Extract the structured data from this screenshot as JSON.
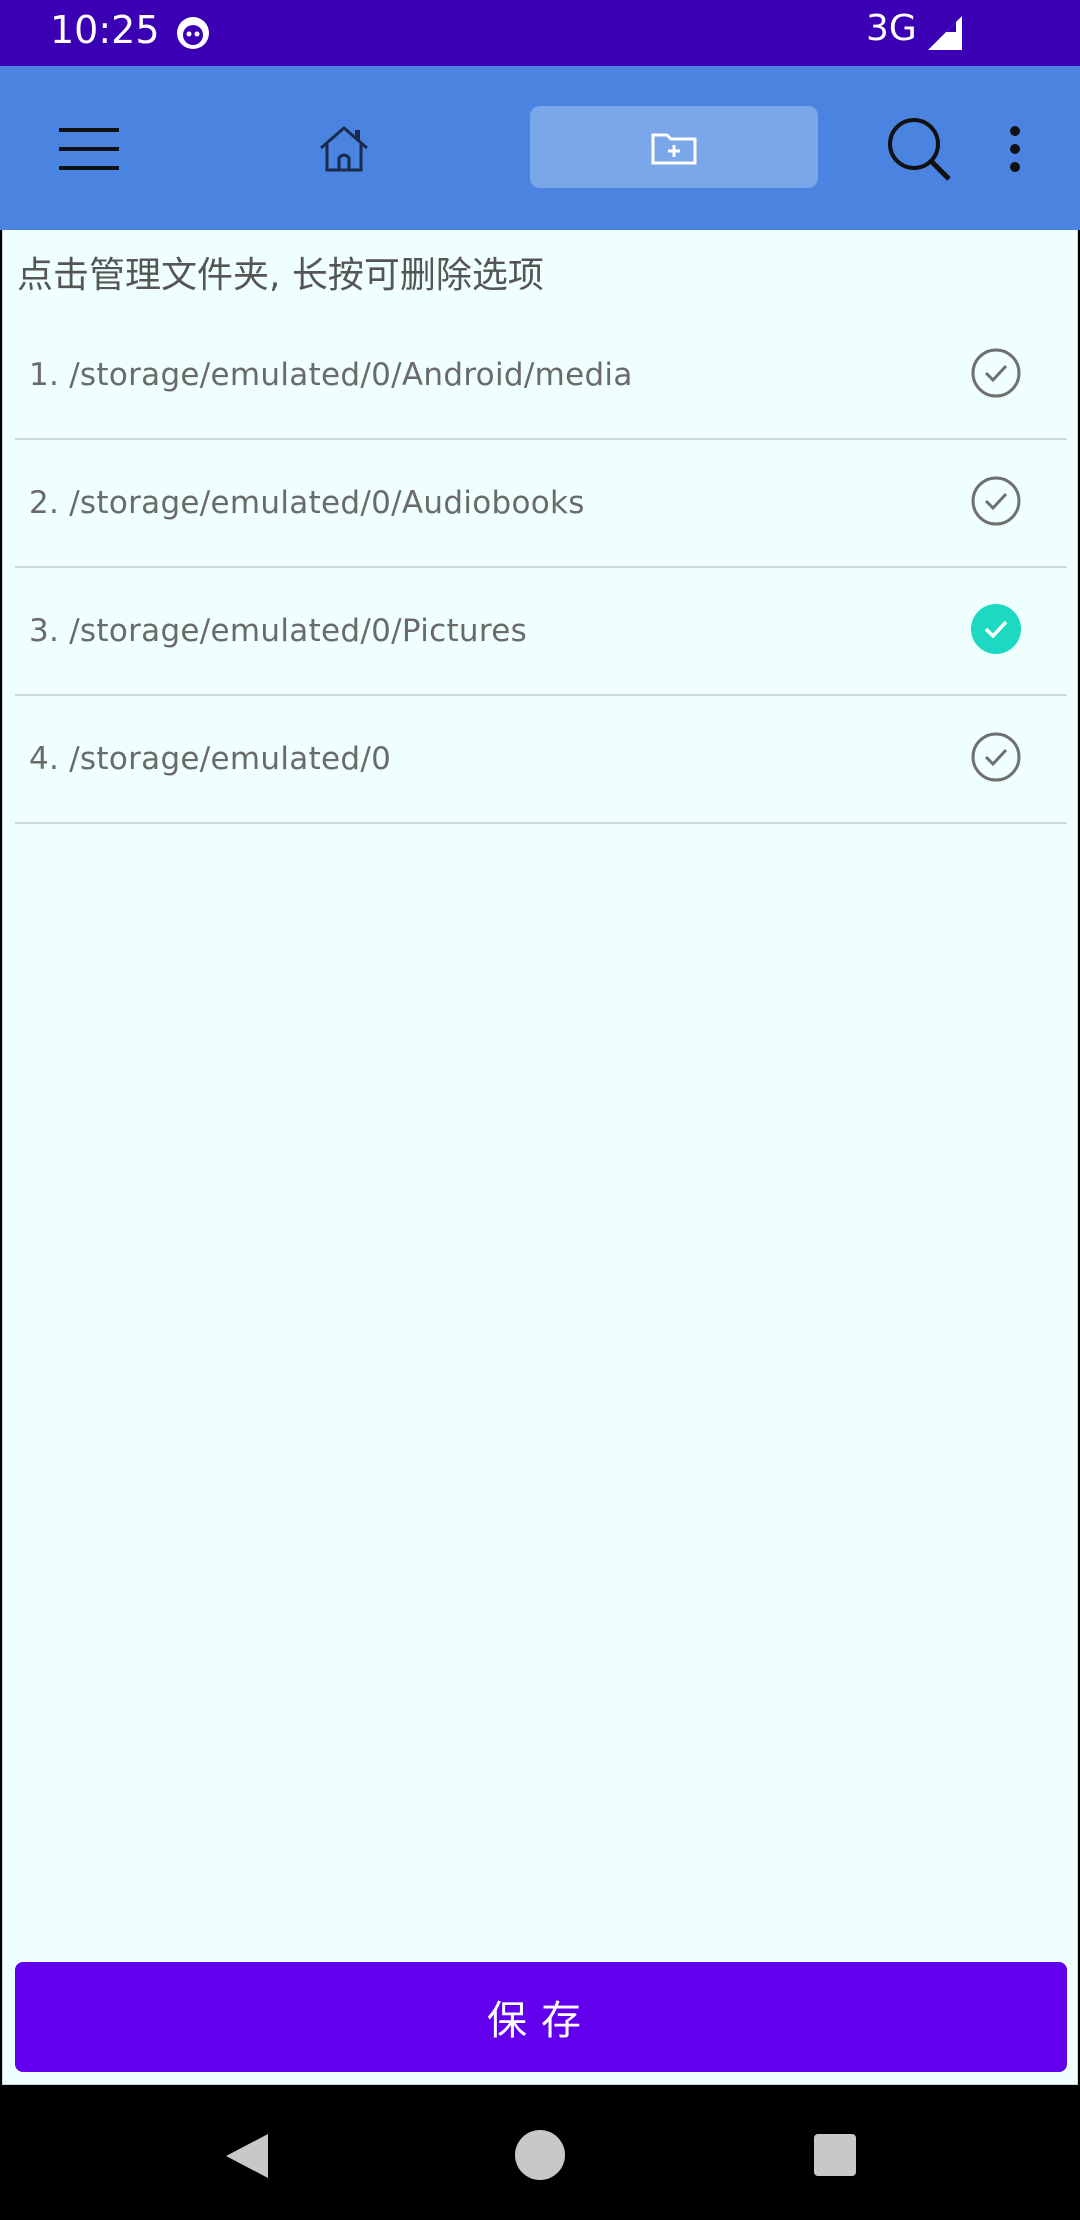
{
  "status_bar": {
    "time": "10:25",
    "network": "3G",
    "background": "#3b00b3"
  },
  "toolbar": {
    "background": "#4a84e0",
    "icons": [
      "menu-icon",
      "home-icon",
      "folder-add-icon",
      "search-icon",
      "more-vert-icon"
    ]
  },
  "main": {
    "hint": "点击管理文件夹, 长按可删除选项",
    "folders": [
      {
        "index": "1.",
        "path": "/storage/emulated/0/Android/media",
        "checked": false
      },
      {
        "index": "2.",
        "path": "/storage/emulated/0/Audiobooks",
        "checked": false
      },
      {
        "index": "3.",
        "path": "/storage/emulated/0/Pictures",
        "checked": true
      },
      {
        "index": "4.",
        "path": "/storage/emulated/0",
        "checked": false
      }
    ],
    "save_label": "保存",
    "save_color": "#6200ee",
    "check_color": "#1dd9c2"
  }
}
